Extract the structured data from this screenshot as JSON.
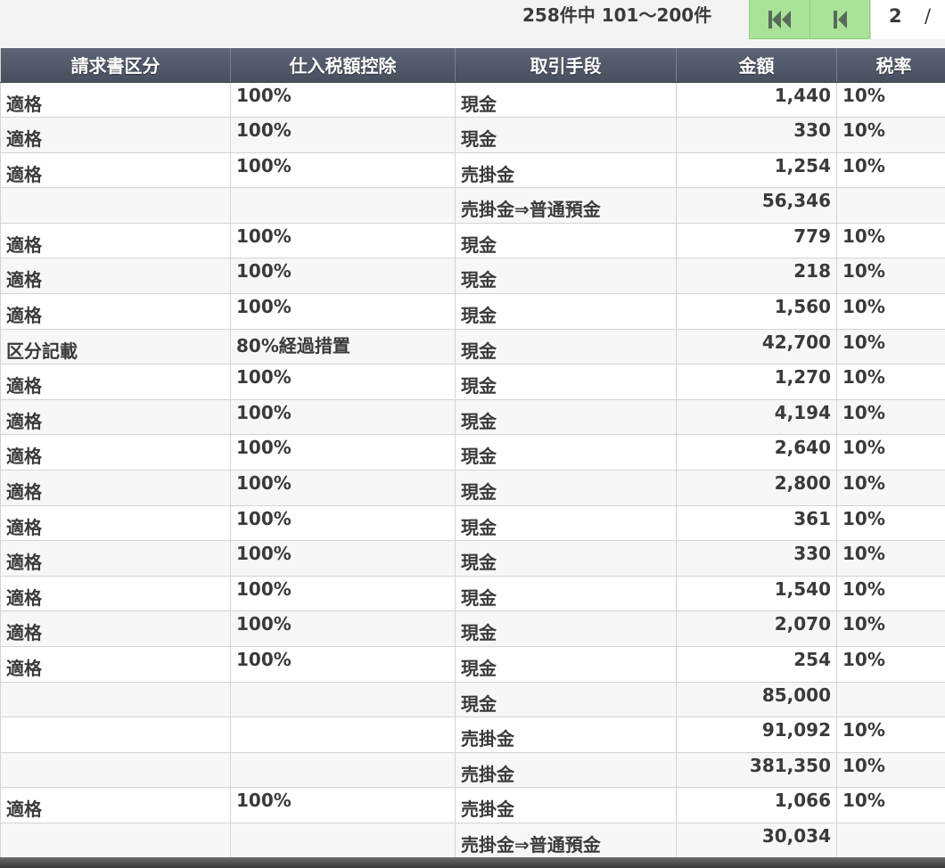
{
  "pager": {
    "count_label": "258件中 101〜200件",
    "first_icon": "skip-to-first-icon",
    "prev_icon": "step-back-icon",
    "current_page": "2",
    "separator": "/",
    "accent_color": "#a9e399"
  },
  "table": {
    "header_color": "#535a6a",
    "columns": [
      "請求書区分",
      "仕入税額控除",
      "取引手段",
      "金額",
      "税率"
    ],
    "rows": [
      [
        "適格",
        "100%",
        "現金",
        "1,440",
        "10%"
      ],
      [
        "適格",
        "100%",
        "現金",
        "330",
        "10%"
      ],
      [
        "適格",
        "100%",
        "売掛金",
        "1,254",
        "10%"
      ],
      [
        "",
        "",
        "売掛金⇒普通預金",
        "56,346",
        ""
      ],
      [
        "適格",
        "100%",
        "現金",
        "779",
        "10%"
      ],
      [
        "適格",
        "100%",
        "現金",
        "218",
        "10%"
      ],
      [
        "適格",
        "100%",
        "現金",
        "1,560",
        "10%"
      ],
      [
        "区分記載",
        "80%経過措置",
        "現金",
        "42,700",
        "10%"
      ],
      [
        "適格",
        "100%",
        "現金",
        "1,270",
        "10%"
      ],
      [
        "適格",
        "100%",
        "現金",
        "4,194",
        "10%"
      ],
      [
        "適格",
        "100%",
        "現金",
        "2,640",
        "10%"
      ],
      [
        "適格",
        "100%",
        "現金",
        "2,800",
        "10%"
      ],
      [
        "適格",
        "100%",
        "現金",
        "361",
        "10%"
      ],
      [
        "適格",
        "100%",
        "現金",
        "330",
        "10%"
      ],
      [
        "適格",
        "100%",
        "現金",
        "1,540",
        "10%"
      ],
      [
        "適格",
        "100%",
        "現金",
        "2,070",
        "10%"
      ],
      [
        "適格",
        "100%",
        "現金",
        "254",
        "10%"
      ],
      [
        "",
        "",
        "現金",
        "85,000",
        ""
      ],
      [
        "",
        "",
        "売掛金",
        "91,092",
        "10%"
      ],
      [
        "",
        "",
        "売掛金",
        "381,350",
        "10%"
      ],
      [
        "適格",
        "100%",
        "売掛金",
        "1,066",
        "10%"
      ],
      [
        "",
        "",
        "売掛金⇒普通預金",
        "30,034",
        ""
      ]
    ]
  }
}
